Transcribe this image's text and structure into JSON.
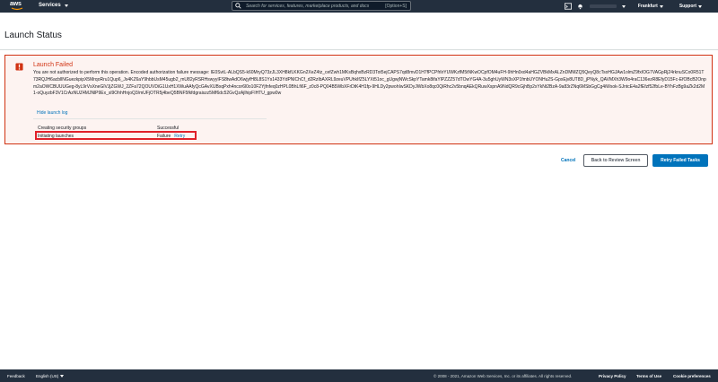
{
  "nav": {
    "logo_text": "aws",
    "services_label": "Services",
    "search_placeholder": "Search for services, features, marketplace products, and docs",
    "search_shortcut": "[Option+S]",
    "region_label": "Frankfurt",
    "support_label": "Support"
  },
  "page": {
    "title": "Launch Status"
  },
  "error": {
    "title": "Launch Failed",
    "message": "You are not authorized to perform this operation. Encoded authorization failure message: IE0SvtL-ALbQS5-k60MryQ73zJL3XH8kfLKKGn2XeZ4tz_cefZwh1MKsBqhxBzRD3Tot5ejCAPS7qd8mvD1H7fPCPfrlirYUWKzfM5tNKwOCpfOM4uFH-9hHn0xd4aHGZVBkMxALZnDMMZQ5QeyQ8cTsoHGJAw1olmZ9fxIOG7VAGpRj24rknuSCo0R51T73RQJH6acbllNGuezkpipX5MrqoRru1Qup6_Js4KZ6aY9hbbUsM45ugb2_mU82yRSRHswyyIFS8twAdO6wjyfH8L8S1Ys1433YdPNlChCf_d2RzIbAXRL9zeuVPUhkIfZ5LYXt51oc_gUgwjNWcSkpYTamk8ifaYlPZZZ57dTOwYG4A-3u5ghUyWN3sXP1fmbUYONHu2S-GpxEjv8UT8D_jPNyk_QAVMXh3W9o4raC136ezR8EfyD15Fc-EfOBcB2Onpm2aOWCBUUUGeg-8yL9rVsXneGlVJjZGWJ_2ZFa72QOUVDiG1UxH1XWuAAfyQcGAvXUBxqPxh4ncor6l0o10F2Yjfnfeq0zHPL0BhLfi6F_z0c8-PQ04B5WbXFrDtK4H1fp-9HLDy2pwohIwSKDyJWbXo8qc0QiRhc2v5bnqAEkQRuwXspnA9NdQR9cGjhBp2xYkNt2BzA-9a83rZNq6MSbGgCg4iWsok-SJntcE4a2fEfzf52fbLe-BYhFzBg9aZk2d2M1-oQuyzbF3V1CrAzNUZ4MJNlP9Ex_sl9OhhHnjoQ3/mUFjOTR5j4beQ5BNF5fkfdgraiszz5Mf6dc52GvQzAjlhipFIHTU_gpw0w",
    "hide_log_label": "Hide launch log",
    "rows": [
      {
        "label": "Creating security groups",
        "status": "Successful",
        "retry": ""
      },
      {
        "label": "Initiating launches",
        "status": "Failure",
        "retry": "Retry"
      }
    ]
  },
  "actions": {
    "cancel_label": "Cancel",
    "review_label": "Back to Review Screen",
    "retry_failed_label": "Retry Failed Tasks"
  },
  "footer": {
    "feedback_label": "Feedback",
    "language_label": "English (US)",
    "copyright": "© 2008 - 2021, Amazon Web Services, Inc. or its affiliates. All rights reserved.",
    "privacy_label": "Privacy Policy",
    "terms_label": "Terms of Use",
    "cookie_label": "Cookie preferences"
  },
  "colors": {
    "nav_bg": "#232f3e",
    "error_red": "#d13212",
    "link_blue": "#0073bb",
    "highlight_red": "#e0202a"
  },
  "icons": [
    "aws-logo-icon",
    "search-icon",
    "terminal-icon",
    "bell-icon",
    "chevron-down-icon",
    "error-icon"
  ]
}
